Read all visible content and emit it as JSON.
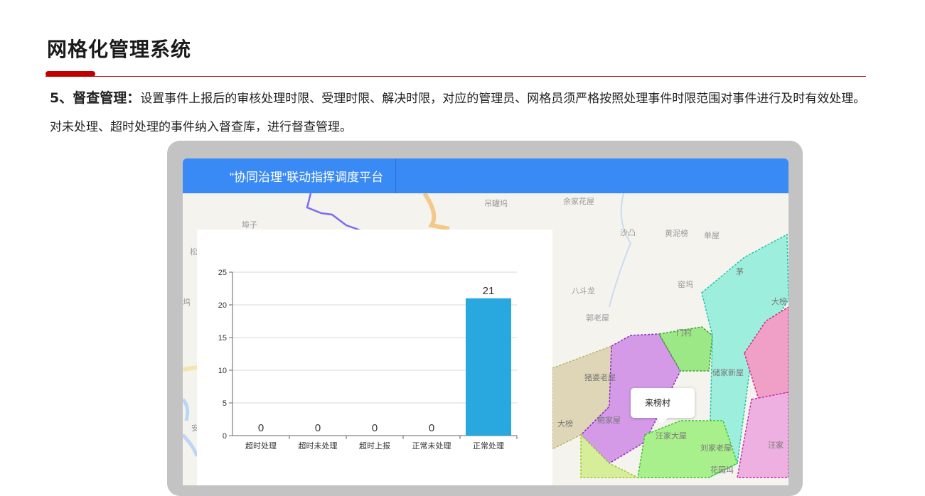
{
  "header": {
    "title": "网格化管理系统"
  },
  "description": {
    "heading": "5、督查管理：",
    "body": "设置事件上报后的审核处理时限、受理时限、解决时限，对应的管理员、网格员须严格按照处理事件时限范围对事件进行及时有效处理。对未处理、超时处理的事件纳入督查库，进行督查管理。"
  },
  "platform": {
    "title": "\"协同治理\"联动指挥调度平台"
  },
  "map": {
    "labels": {
      "l1": "吊罐坞",
      "l2": "余家花屋",
      "l3": "沙凸",
      "l4": "黄泥榜",
      "l5": "单屋",
      "l6": "埠子",
      "l7": "八斗龙",
      "l8": "窑坞",
      "l9": "郭老屋",
      "l10": "猪婆老屋",
      "l11": "储家新屋",
      "l12": "大榜",
      "l13": "大榜",
      "l14": "鲍家屋",
      "l15": "汪家大屋",
      "l16": "刘家老屋",
      "l17": "汪家",
      "l18": "茅",
      "l19": "松",
      "l20": "坞",
      "l21": "安",
      "l22": "门村",
      "l23": "花园坞"
    },
    "tooltip": "来榜村"
  },
  "chart_data": {
    "type": "bar",
    "categories": [
      "超时处理",
      "超时未处理",
      "超时上报",
      "正常未处理",
      "正常处理"
    ],
    "values": [
      0,
      0,
      0,
      0,
      21
    ],
    "ylim": [
      0,
      25
    ],
    "yticks": [
      0,
      5,
      10,
      15,
      20,
      25
    ],
    "bar_color": "#29a8e0",
    "grid": true
  }
}
